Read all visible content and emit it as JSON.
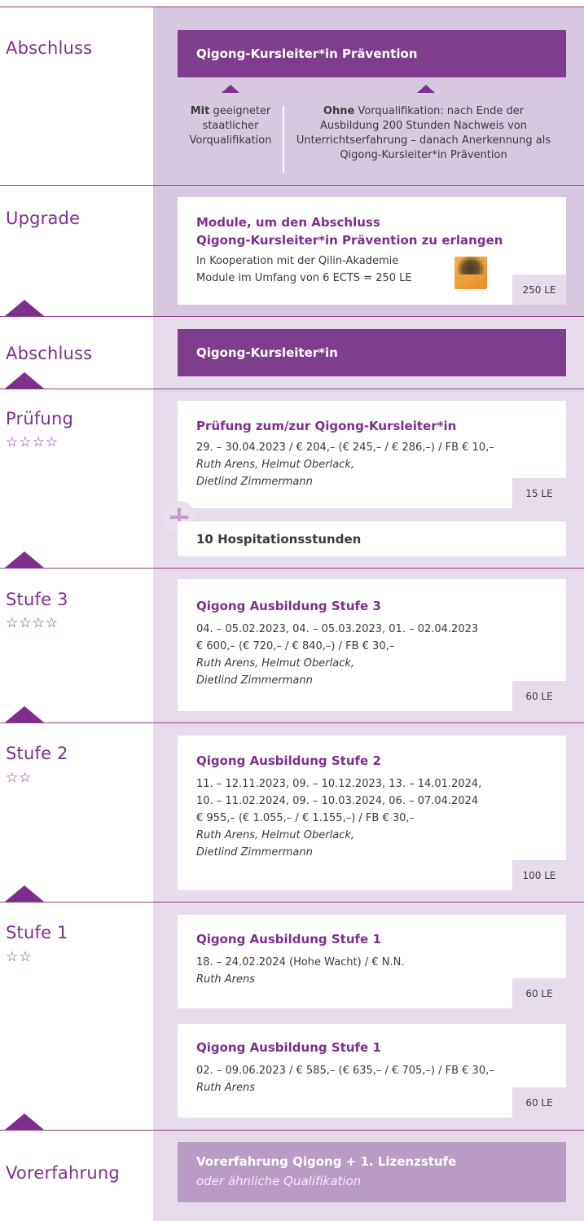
{
  "sections": {
    "abschluss_top": {
      "label": "Abschluss",
      "bar": "Qigong-Kursleiter*in Prävention",
      "mit_bold": "Mit",
      "mit_rest": " geeigneter staatlicher Vorqualifikation",
      "ohne_bold": "Ohne",
      "ohne_rest": " Vorqualifikation: nach Ende der Ausbildung 200 Stunden Nachweis von Unterrichtserfahrung – danach Anerkennung als Qigong-Kursleiter*in Prävention"
    },
    "upgrade": {
      "label": "Upgrade",
      "title1": "Module, um den Abschluss",
      "title2": "Qigong-Kursleiter*in Prävention zu erlangen",
      "line1": "In Kooperation mit der Qilin-Akademie",
      "line2": "Module im Umfang von 6 ECTS = 250 LE",
      "le": "250 LE",
      "logo_icon": "qilin-logo-icon"
    },
    "abschluss_mid": {
      "label": "Abschluss",
      "bar": "Qigong-Kursleiter*in"
    },
    "pruefung": {
      "label": "Prüfung",
      "stars": "☆☆☆☆",
      "title": "Prüfung zum/zur Qigong-Kursleiter*in",
      "line1": "29. – 30.04.2023 / € 204,– (€ 245,– / € 286,–) / FB € 10,–",
      "line2": "Ruth Arens, Helmut Oberlack,",
      "line3": "Dietlind Zimmermann",
      "le": "15 LE",
      "hosp": "10 Hospitationsstunden"
    },
    "stufe3": {
      "label": "Stufe 3",
      "stars": "☆☆☆☆",
      "title": "Qigong Ausbildung Stufe 3",
      "line1": "04. – 05.02.2023, 04. – 05.03.2023, 01. – 02.04.2023",
      "line2": "€ 600,– (€ 720,– / € 840,–) / FB € 30,–",
      "line3": "Ruth Arens, Helmut Oberlack,",
      "line4": "Dietlind Zimmermann",
      "le": "60 LE"
    },
    "stufe2": {
      "label": "Stufe 2",
      "stars": "☆☆",
      "title": "Qigong Ausbildung Stufe 2",
      "line1": "11. – 12.11.2023, 09. – 10.12.2023, 13. – 14.01.2024,",
      "line2": "10. – 11.02.2024, 09. – 10.03.2024, 06. – 07.04.2024",
      "line3": "€ 955,– (€ 1.055,– / € 1.155,–) / FB € 30,–",
      "line4": "Ruth Arens, Helmut Oberlack,",
      "line5": "Dietlind Zimmermann",
      "le": "100 LE"
    },
    "stufe1": {
      "label": "Stufe 1",
      "stars": "☆☆",
      "card1": {
        "title": "Qigong Ausbildung Stufe 1",
        "line1": "18. – 24.02.2024 (Hohe Wacht) / € N.N.",
        "line2": "Ruth Arens",
        "le": "60 LE"
      },
      "card2": {
        "title": "Qigong Ausbildung Stufe 1",
        "line1": "02. – 09.06.2023 / € 585,– (€ 635,– / € 705,–) / FB € 30,–",
        "line2": "Ruth Arens",
        "le": "60 LE"
      }
    },
    "vorerfahrung": {
      "label": "Vorerfahrung",
      "title": "Vorerfahrung Qigong + 1. Lizenzstufe",
      "sub": "oder ähnliche Qualifikation"
    }
  },
  "colors": {
    "accent": "#7e2f8e",
    "column": "#e6dceb",
    "column_dark": "#d7c7df",
    "bar": "#7e3e8d",
    "vor_box": "#b99bc4"
  }
}
